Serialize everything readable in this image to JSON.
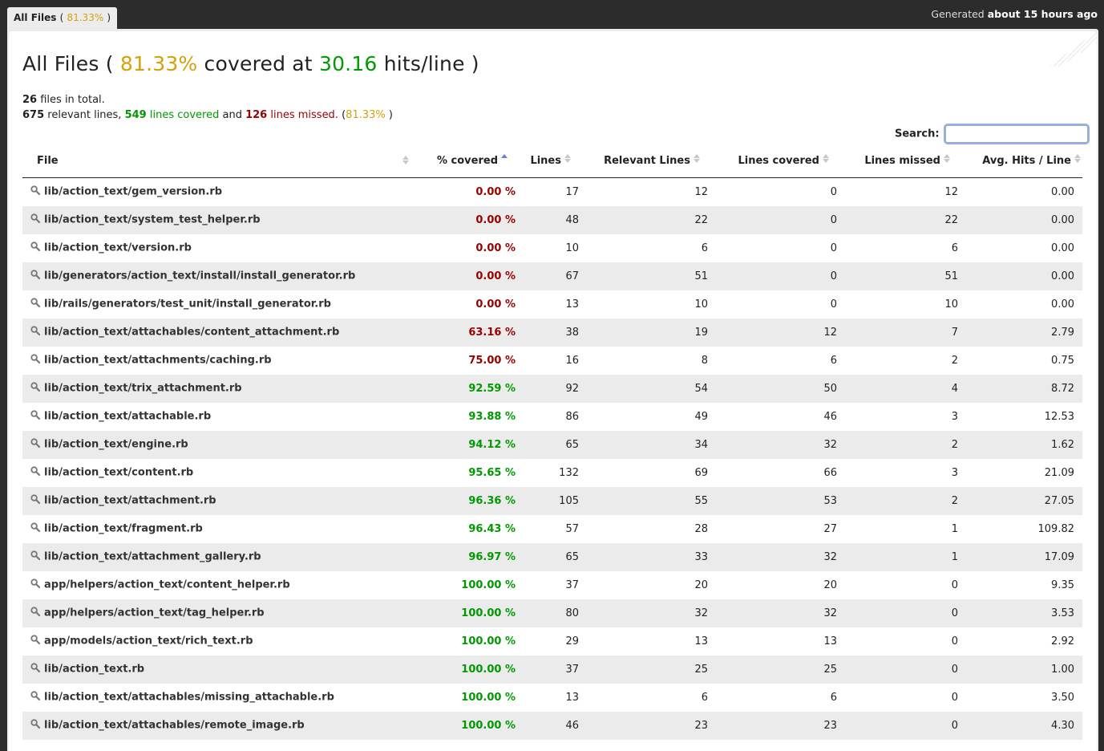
{
  "tab": {
    "label": "All Files",
    "open": "(",
    "percent": "81.33%",
    "close": ")"
  },
  "generated": {
    "prefix": "Generated",
    "when": "about 15 hours ago"
  },
  "title": {
    "prefix": "All Files (",
    "percent": "81.33%",
    "mid": "covered at",
    "hits": "30.16",
    "suffix": "hits/line )"
  },
  "summary": {
    "files_total": "26",
    "files_text": "files in total.",
    "relevant": "675",
    "relevant_text": "relevant lines,",
    "covered": "549",
    "covered_text": "lines covered",
    "and_text": "and",
    "missed": "126",
    "missed_text": "lines missed.",
    "pct_open": "(",
    "percent": "81.33%",
    "pct_close": ")"
  },
  "search": {
    "label": "Search:",
    "value": ""
  },
  "columns": [
    "File",
    "% covered",
    "Lines",
    "Relevant Lines",
    "Lines covered",
    "Lines missed",
    "Avg. Hits / Line"
  ],
  "rows": [
    {
      "file": "lib/action_text/gem_version.rb",
      "cov": "0.00 %",
      "lines": "17",
      "relevant": "12",
      "covered": "0",
      "missed": "12",
      "avg": "0.00"
    },
    {
      "file": "lib/action_text/system_test_helper.rb",
      "cov": "0.00 %",
      "lines": "48",
      "relevant": "22",
      "covered": "0",
      "missed": "22",
      "avg": "0.00"
    },
    {
      "file": "lib/action_text/version.rb",
      "cov": "0.00 %",
      "lines": "10",
      "relevant": "6",
      "covered": "0",
      "missed": "6",
      "avg": "0.00"
    },
    {
      "file": "lib/generators/action_text/install/install_generator.rb",
      "cov": "0.00 %",
      "lines": "67",
      "relevant": "51",
      "covered": "0",
      "missed": "51",
      "avg": "0.00"
    },
    {
      "file": "lib/rails/generators/test_unit/install_generator.rb",
      "cov": "0.00 %",
      "lines": "13",
      "relevant": "10",
      "covered": "0",
      "missed": "10",
      "avg": "0.00"
    },
    {
      "file": "lib/action_text/attachables/content_attachment.rb",
      "cov": "63.16 %",
      "lines": "38",
      "relevant": "19",
      "covered": "12",
      "missed": "7",
      "avg": "2.79"
    },
    {
      "file": "lib/action_text/attachments/caching.rb",
      "cov": "75.00 %",
      "lines": "16",
      "relevant": "8",
      "covered": "6",
      "missed": "2",
      "avg": "0.75"
    },
    {
      "file": "lib/action_text/trix_attachment.rb",
      "cov": "92.59 %",
      "lines": "92",
      "relevant": "54",
      "covered": "50",
      "missed": "4",
      "avg": "8.72"
    },
    {
      "file": "lib/action_text/attachable.rb",
      "cov": "93.88 %",
      "lines": "86",
      "relevant": "49",
      "covered": "46",
      "missed": "3",
      "avg": "12.53"
    },
    {
      "file": "lib/action_text/engine.rb",
      "cov": "94.12 %",
      "lines": "65",
      "relevant": "34",
      "covered": "32",
      "missed": "2",
      "avg": "1.62"
    },
    {
      "file": "lib/action_text/content.rb",
      "cov": "95.65 %",
      "lines": "132",
      "relevant": "69",
      "covered": "66",
      "missed": "3",
      "avg": "21.09"
    },
    {
      "file": "lib/action_text/attachment.rb",
      "cov": "96.36 %",
      "lines": "105",
      "relevant": "55",
      "covered": "53",
      "missed": "2",
      "avg": "27.05"
    },
    {
      "file": "lib/action_text/fragment.rb",
      "cov": "96.43 %",
      "lines": "57",
      "relevant": "28",
      "covered": "27",
      "missed": "1",
      "avg": "109.82"
    },
    {
      "file": "lib/action_text/attachment_gallery.rb",
      "cov": "96.97 %",
      "lines": "65",
      "relevant": "33",
      "covered": "32",
      "missed": "1",
      "avg": "17.09"
    },
    {
      "file": "app/helpers/action_text/content_helper.rb",
      "cov": "100.00 %",
      "lines": "37",
      "relevant": "20",
      "covered": "20",
      "missed": "0",
      "avg": "9.35"
    },
    {
      "file": "app/helpers/action_text/tag_helper.rb",
      "cov": "100.00 %",
      "lines": "80",
      "relevant": "32",
      "covered": "32",
      "missed": "0",
      "avg": "3.53"
    },
    {
      "file": "app/models/action_text/rich_text.rb",
      "cov": "100.00 %",
      "lines": "29",
      "relevant": "13",
      "covered": "13",
      "missed": "0",
      "avg": "2.92"
    },
    {
      "file": "lib/action_text.rb",
      "cov": "100.00 %",
      "lines": "37",
      "relevant": "25",
      "covered": "25",
      "missed": "0",
      "avg": "1.00"
    },
    {
      "file": "lib/action_text/attachables/missing_attachable.rb",
      "cov": "100.00 %",
      "lines": "13",
      "relevant": "6",
      "covered": "6",
      "missed": "0",
      "avg": "3.50"
    },
    {
      "file": "lib/action_text/attachables/remote_image.rb",
      "cov": "100.00 %",
      "lines": "46",
      "relevant": "23",
      "covered": "23",
      "missed": "0",
      "avg": "4.30"
    }
  ],
  "colors": {
    "gold": "#d4a10a",
    "green": "#009900",
    "red": "#990000",
    "sort_active": "#6a7fd2"
  }
}
